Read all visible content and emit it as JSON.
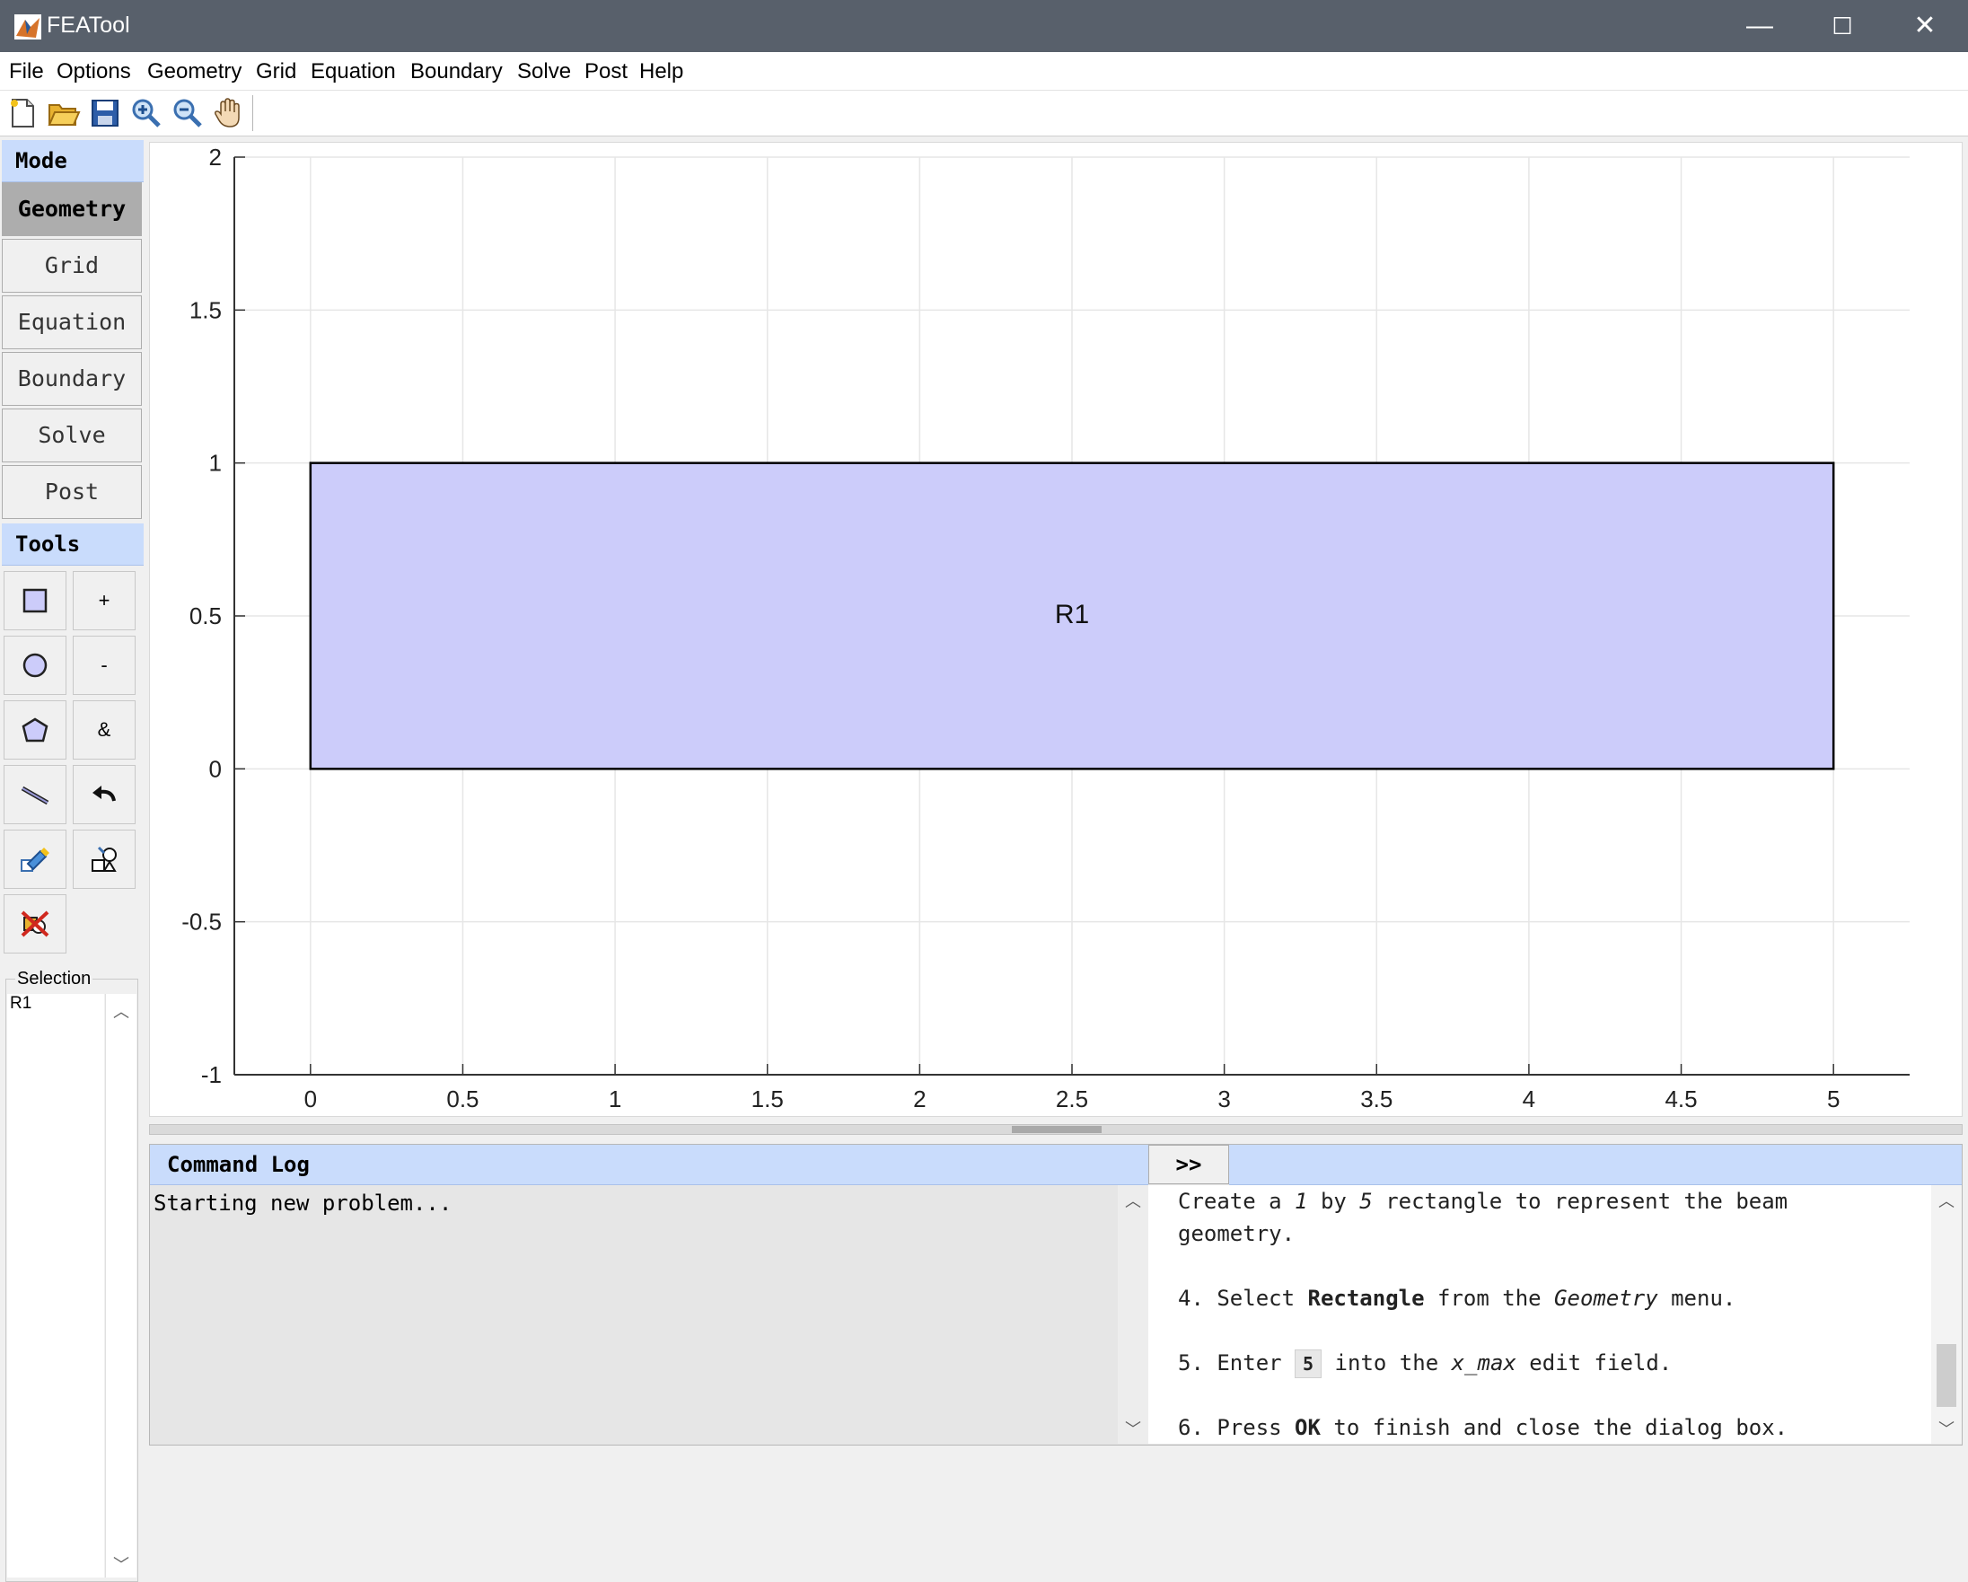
{
  "window": {
    "title": "FEATool",
    "minimize": "—",
    "maximize": "☐",
    "close": "✕"
  },
  "menu": [
    "File",
    "Options",
    "Geometry",
    "Grid",
    "Equation",
    "Boundary",
    "Solve",
    "Post",
    "Help"
  ],
  "toolbar": [
    "new-file-icon",
    "open-folder-icon",
    "save-icon",
    "zoom-in-icon",
    "zoom-out-icon",
    "pan-hand-icon"
  ],
  "sidebar": {
    "mode_header": "Mode",
    "modes": [
      "Geometry",
      "Grid",
      "Equation",
      "Boundary",
      "Solve",
      "Post"
    ],
    "active_mode": "Geometry",
    "tools_header": "Tools",
    "tools": {
      "union_label": "+",
      "subtract_label": "-",
      "intersect_label": "&"
    },
    "selection_label": "Selection",
    "selection_items": [
      "R1"
    ]
  },
  "plot": {
    "object_label": "R1",
    "fill_color": "#ccccfa",
    "x_ticks": [
      "0",
      "0.5",
      "1",
      "1.5",
      "2",
      "2.5",
      "3",
      "3.5",
      "4",
      "4.5",
      "5"
    ],
    "y_ticks": [
      "2",
      "1.5",
      "1",
      "0.5",
      "0",
      "-0.5",
      "-1"
    ],
    "xlim": [
      -0.25,
      5.25
    ],
    "ylim": [
      -1,
      2
    ],
    "rectangle": {
      "x_min": 0,
      "x_max": 5,
      "y_min": 0,
      "y_max": 1
    }
  },
  "log": {
    "header": "Command Log",
    "expand_label": ">>",
    "text": "Starting new problem..."
  },
  "help": {
    "intro_a": "Create a ",
    "intro_1": "1",
    "intro_b": " by ",
    "intro_5": "5",
    "intro_c": " rectangle to represent the beam",
    "intro_d": "geometry.",
    "step4_a": "4. Select ",
    "step4_b": "Rectangle",
    "step4_c": " from the ",
    "step4_d": "Geometry",
    "step4_e": " menu.",
    "step5_a": "5. Enter ",
    "step5_key": "5",
    "step5_b": " into the ",
    "step5_c": "x_max",
    "step5_d": " edit field.",
    "step6_a": "6. Press ",
    "step6_b": "OK",
    "step6_c": " to finish and close the dialog box."
  }
}
